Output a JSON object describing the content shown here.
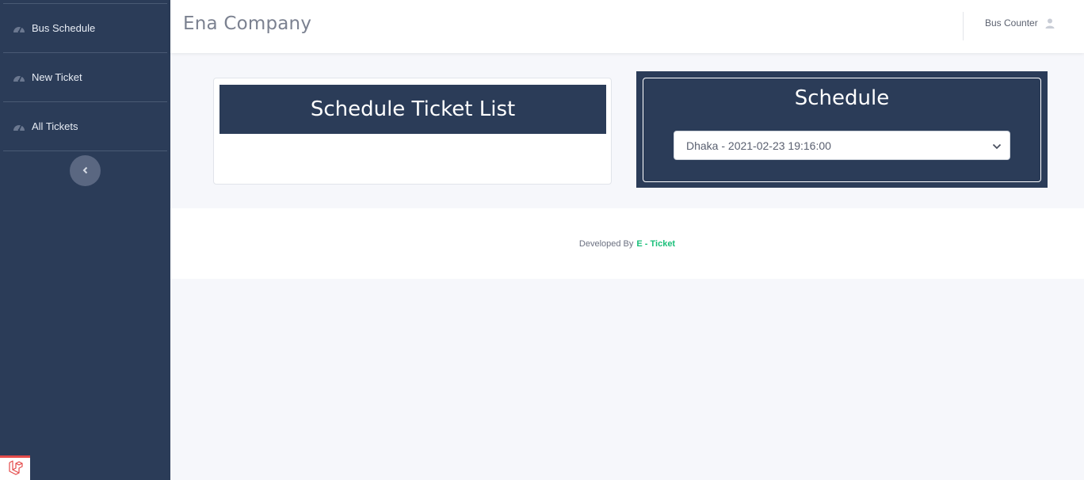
{
  "sidebar": {
    "items": [
      {
        "label": "Bus Schedule",
        "icon": "dashboard-gauge-icon"
      },
      {
        "label": "New Ticket",
        "icon": "dashboard-gauge-icon"
      },
      {
        "label": "All Tickets",
        "icon": "dashboard-gauge-icon"
      }
    ],
    "collapse_icon": "chevron-left-icon"
  },
  "header": {
    "brand": "Ena Company",
    "user_label": "Bus Counter",
    "user_icon": "user-icon"
  },
  "ticket_list_card": {
    "title": "Schedule Ticket List"
  },
  "schedule_card": {
    "title": "Schedule",
    "selected": "Dhaka - 2021-02-23 19:16:00"
  },
  "footer": {
    "prefix": "Developed By",
    "brand": "E - Ticket"
  },
  "colors": {
    "sidebar_bg": "#2b3c58",
    "accent_green": "#1bbf7a",
    "page_bg": "#f6f7fb"
  }
}
